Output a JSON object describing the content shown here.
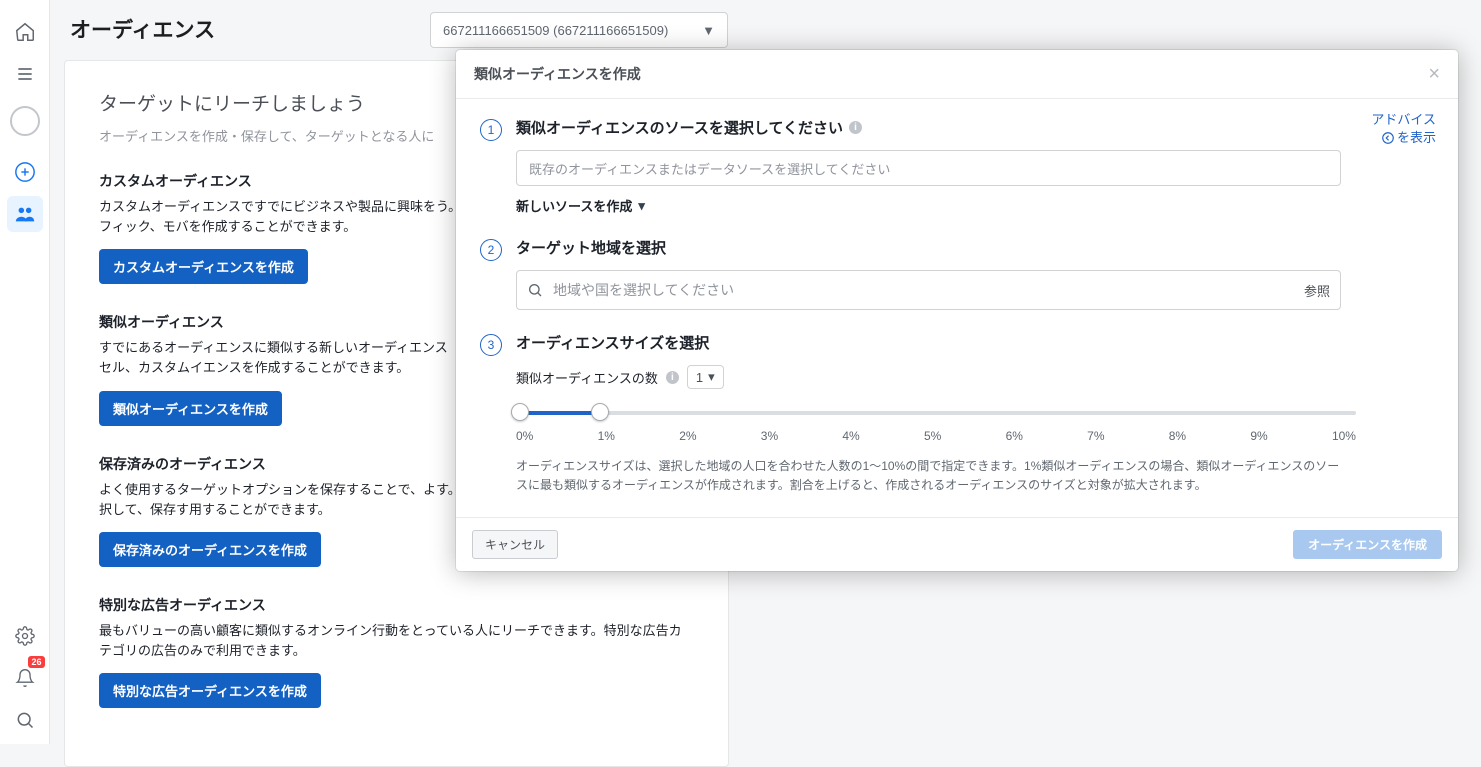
{
  "leftnav": {
    "home": "home",
    "menu": "menu",
    "plus": "plus",
    "audiences": "audiences",
    "settings": "settings",
    "notifications_badge": "26",
    "search": "search"
  },
  "header": {
    "title": "オーディエンス",
    "account_label": "667211166651509 (667211166651509)"
  },
  "main": {
    "title": "ターゲットにリーチしましょう",
    "subtitle": "オーディエンスを作成・保存して、ターゲットとなる人に",
    "sections": [
      {
        "title": "カスタムオーディエンス",
        "desc": "カスタムオーディエンスですでにビジネスや製品に興味をう。カスタマーリストやウェブサイトトラフィック、モバを作成することができます。",
        "button": "カスタムオーディエンスを作成"
      },
      {
        "title": "類似オーディエンス",
        "desc": "すでにあるオーディエンスに類似する新しいオーディエンス「いいね!」した人やコンバージョンピクセル、カスタムイエンスを作成することができます。",
        "button": "類似オーディエンスを作成"
      },
      {
        "title": "保存済みのオーディエンス",
        "desc": "よく使用するターゲットオプションを保存することで、よす。利用者層や興味・関心、行動などを選択して、保存す用することができます。",
        "button": "保存済みのオーディエンスを作成"
      },
      {
        "title": "特別な広告オーディエンス",
        "desc": "最もバリューの高い顧客に類似するオンライン行動をとっている人にリーチできます。特別な広告カテゴリの広告のみで利用できます。",
        "button": "特別な広告オーディエンスを作成"
      }
    ]
  },
  "modal": {
    "title": "類似オーディエンスを作成",
    "advice_line1": "アドバイス",
    "advice_line2": "を表示",
    "step1": {
      "num": "1",
      "title": "類似オーディエンスのソースを選択してください",
      "placeholder": "既存のオーディエンスまたはデータソースを選択してください",
      "new_source": "新しいソースを作成"
    },
    "step2": {
      "num": "2",
      "title": "ターゲット地域を選択",
      "placeholder": "地域や国を選択してください",
      "ref": "参照"
    },
    "step3": {
      "num": "3",
      "title": "オーディエンスサイズを選択",
      "count_label": "類似オーディエンスの数",
      "count_value": "1",
      "ticks": [
        "0%",
        "1%",
        "2%",
        "3%",
        "4%",
        "5%",
        "6%",
        "7%",
        "8%",
        "9%",
        "10%"
      ],
      "size_desc": "オーディエンスサイズは、選択した地域の人口を合わせた人数の1～10%の間で指定できます。1%類似オーディエンスの場合、類似オーディエンスのソースに最も類似するオーディエンスが作成されます。割合を上げると、作成されるオーディエンスのサイズと対象が拡大されます。"
    },
    "cancel": "キャンセル",
    "create": "オーディエンスを作成"
  }
}
